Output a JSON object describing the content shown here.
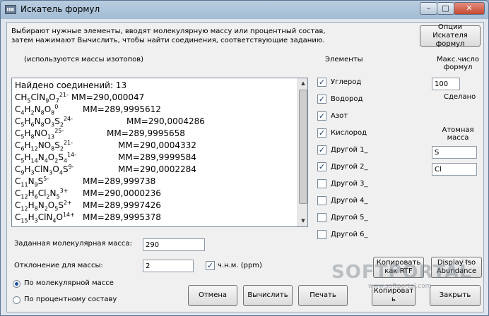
{
  "window": {
    "title": "Искатель формул",
    "min": "–",
    "max": "□",
    "close": "✕"
  },
  "intro": {
    "line1": "Выбирают нужные элементы, вводят молекулярную массу или процентный состав,",
    "line2": "затем нажимают Вычислить, чтобы найти соединения, соответствующие заданию.",
    "isotopes": "(используются массы изотопов)"
  },
  "options_button": {
    "line1": "Опции Искателя",
    "line2": "формул"
  },
  "elements": {
    "header": "Элементы",
    "items": [
      {
        "label": "Углерод",
        "checked": true
      },
      {
        "label": "Водород",
        "checked": true
      },
      {
        "label": "Азот",
        "checked": true
      },
      {
        "label": "Кислород",
        "checked": true
      },
      {
        "label": "Другой 1_",
        "checked": true
      },
      {
        "label": "Другой 2_",
        "checked": true
      },
      {
        "label": "Другой 3_",
        "checked": false
      },
      {
        "label": "Другой 4_",
        "checked": false
      },
      {
        "label": "Другой 5_",
        "checked": false
      },
      {
        "label": "Другой 6_",
        "checked": false
      }
    ]
  },
  "right_panel": {
    "max_formulas_label1": "Макс.число",
    "max_formulas_label2": "формул",
    "max_formulas_value": "100",
    "done": "Сделано",
    "atomic_mass_label1": "Атомная",
    "atomic_mass_label2": "масса",
    "other1_value": "S",
    "other2_value": "Cl"
  },
  "results": {
    "header": "Найдено соединений:  13",
    "rows": [
      {
        "formula": "CH<sub>5</sub>ClN<sub>9</sub>O<sub>7</sub><sup>21-</sup>",
        "mass": "MM=290,000047",
        "indent": 80
      },
      {
        "formula": "C<sub>4</sub>H<sub>2</sub>N<sub>8</sub>O<sub>8</sub><sup>0</sup>",
        "mass": "MM=289,9995612",
        "indent": 96
      },
      {
        "formula": "C<sub>5</sub>H<sub>6</sub>N<sub>8</sub>O<sub>3</sub>S<sub>2</sub><sup>24-</sup>",
        "mass": "MM=290,0004286",
        "indent": 158
      },
      {
        "formula": "C<sub>5</sub>H<sub>8</sub>NO<sub>13</sub><sup>25-</sup>",
        "mass": "MM=289,9995658",
        "indent": 130
      },
      {
        "formula": "C<sub>6</sub>H<sub>12</sub>NO<sub>8</sub>S<sub>2</sub><sup>21-</sup>",
        "mass": "MM=290,0004332",
        "indent": 146
      },
      {
        "formula": "C<sub>5</sub>H<sub>14</sub>N<sub>4</sub>O<sub>2</sub>S<sub>4</sub><sup>14-</sup>",
        "mass": "MM=289,9999584",
        "indent": 146
      },
      {
        "formula": "C<sub>9</sub>H<sub>3</sub>ClN<sub>3</sub>O<sub>4</sub>S<sup>9-</sup>",
        "mass": "MM=290,0002284",
        "indent": 146
      },
      {
        "formula": "C<sub>11</sub>N<sub>9</sub>S<sup>5-</sup>",
        "mass": "MM=289,999738",
        "indent": 96
      },
      {
        "formula": "C<sub>12</sub>H<sub>6</sub>Cl<sub>2</sub>N<sub>5</sub><sup>3+</sup>",
        "mass": "MM=290,0000236",
        "indent": 96
      },
      {
        "formula": "C<sub>12</sub>H<sub>8</sub>N<sub>2</sub>O<sub>5</sub>S<sup>2+</sup>",
        "mass": "MM=289,9997426",
        "indent": 96
      },
      {
        "formula": "C<sub>15</sub>H<sub>3</sub>ClN<sub>4</sub>O<sup>14+</sup>",
        "mass": "MM=289,9995378",
        "indent": 96
      }
    ]
  },
  "inputs": {
    "mass_label": "Заданная молекулярная масса:",
    "mass_value": "290",
    "deviation_label": "Отклонение для массы:",
    "deviation_value": "2",
    "ppm_label": "ч.н.м. (ppm)",
    "ppm_checked": true
  },
  "radios": {
    "by_mass": "По молекулярной массе",
    "by_percent": "По процентному составу"
  },
  "buttons": {
    "copy_rtf_1": "Копировать",
    "copy_rtf_2": "как RTF",
    "display_iso_1": "Display Iso",
    "display_iso_2": "Abundance",
    "cancel": "Отмена",
    "calculate": "Вычислить",
    "print": "Печать",
    "copy_1": "Копироват",
    "copy_2": "ь",
    "close": "Закрыть"
  },
  "watermark": {
    "main": "SOFTPORTAL",
    "tm": "TM",
    "url": "www.softportal.com"
  }
}
